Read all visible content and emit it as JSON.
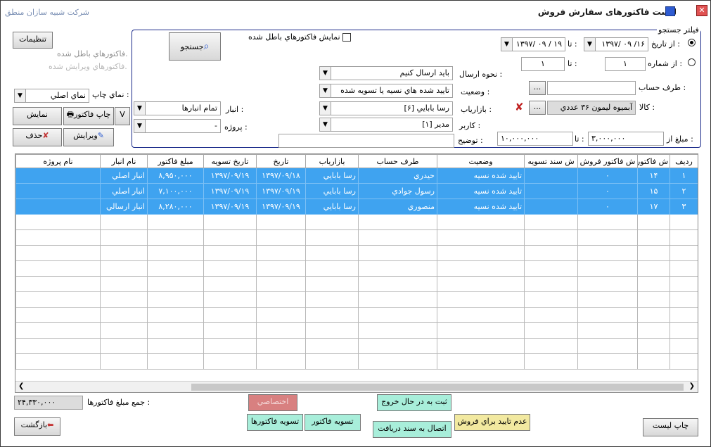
{
  "window": {
    "app_name": "شرکت شبیه سازان منطق",
    "title": "لیست فاکتورهای سفارش فروش"
  },
  "left": {
    "settings_label": "تنظیمات",
    "note_invalid": "فاکتورهاي باطل شده.",
    "note_edited": "فاکتورهاي ويرايش شده.",
    "print_view_label": "نماي چاپ :",
    "print_view_value": "نماي اصلي",
    "print_invoice_label": "چاپ فاکتور",
    "v_label": "V",
    "show_label": "نمايش",
    "edit_label": "ويرايش",
    "delete_label": "حذف"
  },
  "filter": {
    "legend": "فيلتر جستجو",
    "search_label": "جستجو",
    "show_invalid_label": "نمايش فاکتورهاي باطل شده",
    "from_date_label": "از تاريخ :",
    "from_date_value": "۱۳۹۷/ ۰۹ /۱۶",
    "to_label": "تا :",
    "to_date_value": "۱۳۹۷/ ۰۹ / ۱۹",
    "from_num_label": "از شماره :",
    "from_num_value": "۱",
    "to_num_label": "تا :",
    "to_num_value": "۱",
    "party_label": "طرف حساب :",
    "party_value": "",
    "browse": "...",
    "goods_label": "کالا :",
    "goods_value": "آبميوه ليمون ۳۶ عددي",
    "amount_from_label": "مبلغ از :",
    "amount_from_value": "۳,۰۰۰,۰۰۰",
    "amount_to_label": "تا :",
    "amount_to_value": "۱۰,۰۰۰,۰۰۰",
    "send_method_label": "نحوه ارسال :",
    "send_method_value": "بايد ارسال کنيم",
    "status_label": "وضعيت :",
    "status_value": "تاييد شده هاي نسيه يا تسويه شده",
    "marketer_label": "بازارياب :",
    "marketer_value": "رسا بابايي [۶]",
    "user_label": "کاربر :",
    "user_value": "مدير [۱]",
    "desc_label": "توضيح :",
    "desc_value": "",
    "warehouse_label": "انبار :",
    "warehouse_value": "تمام انبارها",
    "project_label": "پروژه :",
    "project_value": "-"
  },
  "grid": {
    "columns": [
      "رديف",
      "ش فاکتور*",
      "ش فاکتور فروش",
      "ش سند تسويه",
      "وضعيت",
      "طرف حساب",
      "بازارياب",
      "تاريخ",
      "تاريخ تسويه",
      "مبلغ فاکتور",
      "نام انبار",
      "نام پروژه"
    ],
    "rows": [
      [
        "۱",
        "۱۴",
        "۰",
        "",
        "تاييد شده نسيه",
        "حيدري",
        "رسا بابايي",
        "۱۳۹۷/۰۹/۱۸",
        "۱۳۹۷/۰۹/۱۹",
        "۸,۹۵۰,۰۰۰",
        "انبار اصلي",
        ""
      ],
      [
        "۲",
        "۱۵",
        "۰",
        "",
        "تاييد شده نسيه",
        "رسول جوادي",
        "رسا بابايي",
        "۱۳۹۷/۰۹/۱۹",
        "۱۳۹۷/۰۹/۱۹",
        "۷,۱۰۰,۰۰۰",
        "انبار اصلي",
        ""
      ],
      [
        "۳",
        "۱۷",
        "۰",
        "",
        "تاييد شده نسيه",
        "منصوري",
        "رسا بابايي",
        "۱۳۹۷/۰۹/۱۹",
        "۱۳۹۷/۰۹/۱۹",
        "۸,۲۸۰,۰۰۰",
        "انبار ارسالي",
        ""
      ]
    ],
    "empty_rows": 10
  },
  "footer": {
    "total_label": "جمع مبلغ فاکتورها :",
    "total_value": "۲۴,۳۳۰,۰۰۰",
    "exclusive_label": "اختصاصي",
    "register_out_label": "ثبت به در حال خروج",
    "settle_invoice_label": "تسويه فاکتور",
    "settle_invoices_label": "تسويه فاکتورها",
    "connect_label": "اتصال به سند دريافت",
    "not_approve_label": "عدم تاييد براي فروش",
    "print_list_label": "چاپ ليست",
    "back_label": "بازگشت"
  },
  "colors": {
    "selected_row": "#3fa3f0",
    "filter_border": "#1a2a8a",
    "exclusive_bg": "#d88080",
    "yellow_btn": "#f2e9a0",
    "green_btn": "#a8eeda"
  }
}
